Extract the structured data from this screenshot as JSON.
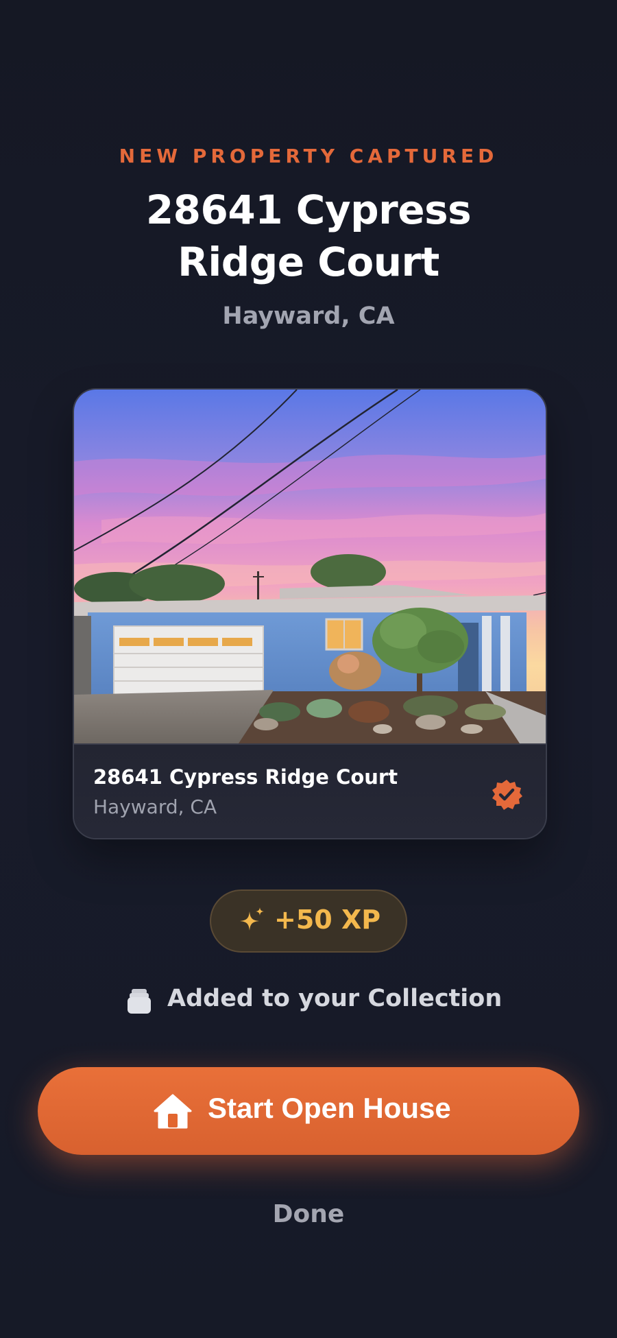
{
  "header": {
    "eyebrow": "NEW PROPERTY CAPTURED",
    "title": "28641 Cypress Ridge Court",
    "subtitle": "Hayward, CA"
  },
  "card": {
    "title": "28641 Cypress Ridge Court",
    "subtitle": "Hayward, CA",
    "badge_icon": "verified-check-icon"
  },
  "reward": {
    "xp_label": "+50 XP",
    "icon": "sparkles-icon"
  },
  "collection": {
    "label": "Added to your Collection",
    "icon": "collection-icon"
  },
  "actions": {
    "primary_label": "Start Open House",
    "primary_icon": "house-icon",
    "secondary_label": "Done"
  },
  "colors": {
    "accent": "#e4693a",
    "xp": "#f3b84d",
    "background": "#171a27"
  }
}
